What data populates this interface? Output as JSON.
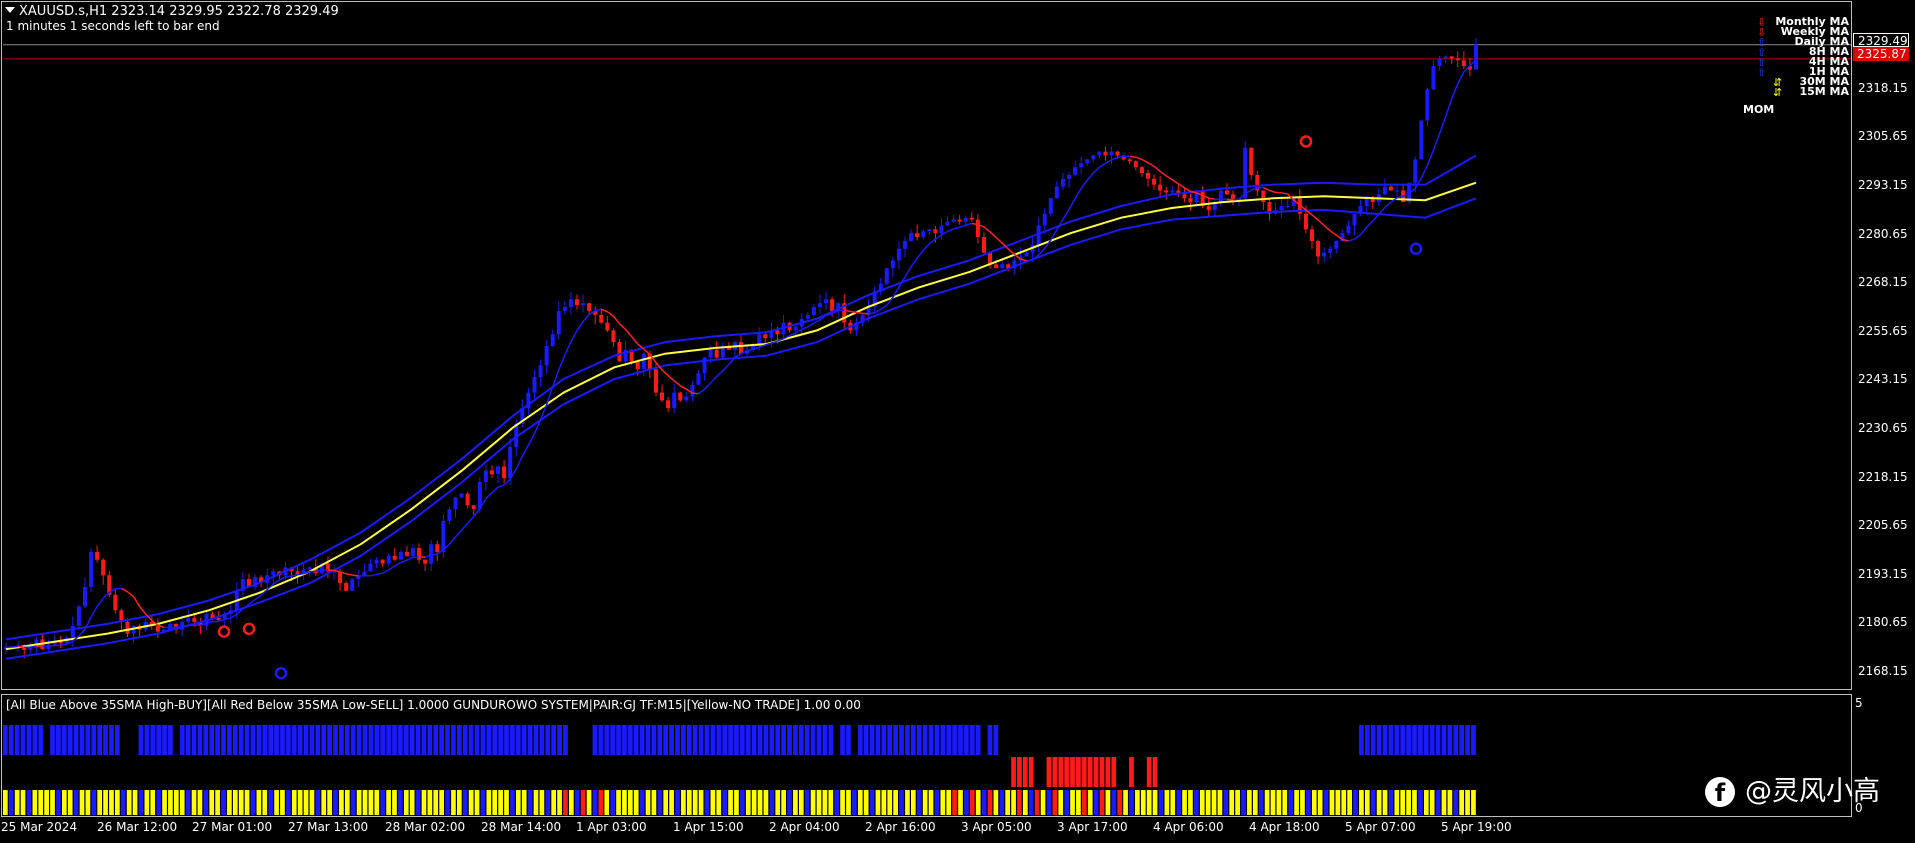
{
  "header": {
    "symbol_ohlc": "XAUUSD.s,H1  2323.14 2329.95 2322.78 2329.49",
    "countdown": "1 minutes 1 seconds left to bar end"
  },
  "price_axis": {
    "labels": [
      "2318.15",
      "2305.65",
      "2293.15",
      "2280.65",
      "2268.15",
      "2255.65",
      "2243.15",
      "2230.65",
      "2218.15",
      "2205.65",
      "2193.15",
      "2180.65",
      "2168.15"
    ],
    "current_price": "2329.49",
    "red_line_price": "2325.87",
    "red_tag_color": "#e00000"
  },
  "time_axis": {
    "labels": [
      "25 Mar 2024",
      "26 Mar 12:00",
      "27 Mar 01:00",
      "27 Mar 13:00",
      "28 Mar 02:00",
      "28 Mar 14:00",
      "1 Apr 03:00",
      "1 Apr 15:00",
      "2 Apr 04:00",
      "2 Apr 16:00",
      "3 Apr 05:00",
      "3 Apr 17:00",
      "4 Apr 06:00",
      "4 Apr 18:00",
      "5 Apr 07:00",
      "5 Apr 19:00"
    ]
  },
  "ma_legend": {
    "items": [
      {
        "label": "Monthly MA",
        "icon": "arrow-down-icon",
        "color": "#ff2020"
      },
      {
        "label": "Weekly MA",
        "icon": "arrow-down-icon",
        "color": "#ff2020"
      },
      {
        "label": "Daily MA",
        "icon": "arrow-up-icon",
        "color": "#2040ff"
      },
      {
        "label": "8H MA",
        "icon": "arrow-up-icon",
        "color": "#2040ff"
      },
      {
        "label": "4H MA",
        "icon": "arrow-up-icon",
        "color": "#2040ff"
      },
      {
        "label": "1H MA",
        "icon": "arrow-up-icon",
        "color": "#2040ff"
      },
      {
        "label": "30M MA",
        "icon": "double-arrow-icon",
        "color": "#ffff00"
      },
      {
        "label": "15M MA",
        "icon": "double-arrow-icon",
        "color": "#ffff00"
      }
    ],
    "mom_label": "MOM"
  },
  "indicator": {
    "text": "[All Blue Above 35SMA High-BUY][All Red Below 35SMA Low-SELL] 1.0000  GUNDUROWO SYSTEM|PAIR:GJ TF:M15|[Yellow-NO TRADE] 1.00 0.00",
    "scale_max": "5",
    "scale_min": "0"
  },
  "watermark": {
    "icon": "facebook-icon",
    "text": "@灵风小高"
  },
  "colors": {
    "bull": "#1a1aff",
    "bear": "#ff1a1a",
    "ma_yellow": "#ffff40",
    "ma_blue": "#1a1aff",
    "ma_red": "#ff2020",
    "no_trade": "#ffff00"
  },
  "chart_data": {
    "type": "candlestick",
    "symbol": "XAUUSD.s",
    "timeframe": "H1",
    "ylim": [
      2164,
      2332
    ],
    "close_path": [
      2174.5,
      2174.6,
      2175.0,
      2173.8,
      2174.3,
      2176.5,
      2174.0,
      2175.2,
      2176.0,
      2175.5,
      2177.0,
      2180.0,
      2185.0,
      2190.0,
      2199.0,
      2197.0,
      2193.0,
      2188.0,
      2184.0,
      2181.0,
      2178.0,
      2180.0,
      2179.0,
      2181.0,
      2180.0,
      2178.5,
      2179.0,
      2180.5,
      2179.0,
      2181.0,
      2182.0,
      2181.0,
      2180.0,
      2183.0,
      2182.0,
      2181.5,
      2183.0,
      2184.0,
      2189.0,
      2192.0,
      2190.0,
      2192.5,
      2191.0,
      2193.0,
      2194.0,
      2193.0,
      2195.0,
      2194.0,
      2193.0,
      2194.5,
      2195.0,
      2193.5,
      2196.0,
      2194.0,
      2194.0,
      2191.0,
      2189.0,
      2192.0,
      2193.0,
      2194.0,
      2196.0,
      2197.0,
      2196.0,
      2198.0,
      2197.0,
      2199.0,
      2198.0,
      2200.0,
      2197.0,
      2196.0,
      2201.0,
      2199.0,
      2207.0,
      2210.0,
      2213.0,
      2214.0,
      2211.0,
      2210.0,
      2217.0,
      2220.0,
      2219.0,
      2221.0,
      2218.0,
      2226.0,
      2232.0,
      2236.0,
      2240.0,
      2244.0,
      2247.0,
      2252.0,
      2255.0,
      2261.0,
      2262.0,
      2264.0,
      2262.5,
      2263.0,
      2261.0,
      2260.0,
      2258.0,
      2256.0,
      2253.0,
      2248.0,
      2251.0,
      2248.0,
      2246.0,
      2250.0,
      2246.0,
      2240.0,
      2238.0,
      2236.0,
      2240.0,
      2238.0,
      2239.0,
      2242.0,
      2245.0,
      2249.0,
      2251.0,
      2249.0,
      2252.0,
      2251.0,
      2253.0,
      2250.0,
      2251.0,
      2252.0,
      2255.0,
      2254.0,
      2256.0,
      2255.0,
      2258.0,
      2256.0,
      2257.0,
      2259.0,
      2260.0,
      2262.0,
      2263.0,
      2264.0,
      2261.0,
      2263.0,
      2258.0,
      2256.0,
      2258.0,
      2260.0,
      2262.0,
      2266.0,
      2268.0,
      2272.0,
      2274.0,
      2277.0,
      2279.0,
      2281.0,
      2280.0,
      2281.5,
      2282.0,
      2281.0,
      2283.0,
      2284.0,
      2284.5,
      2284.0,
      2285.0,
      2284.5,
      2280.0,
      2276.0,
      2273.0,
      2272.0,
      2273.0,
      2272.0,
      2274.0,
      2275.0,
      2276.0,
      2278.0,
      2283.0,
      2286.0,
      2290.0,
      2293.0,
      2295.0,
      2296.0,
      2298.0,
      2299.0,
      2300.0,
      2301.0,
      2302.0,
      2301.0,
      2302.0,
      2301.0,
      2300.0,
      2299.5,
      2298.0,
      2296.5,
      2295.0,
      2293.5,
      2292.0,
      2291.5,
      2292.0,
      2291.0,
      2290.0,
      2289.0,
      2292.0,
      2288.0,
      2287.0,
      2289.0,
      2292.0,
      2291.0,
      2289.0,
      2290.0,
      2303.0,
      2296.0,
      2292.0,
      2289.0,
      2286.0,
      2287.0,
      2288.0,
      2288.0,
      2290.0,
      2286.0,
      2282.0,
      2279.0,
      2275.0,
      2276.0,
      2277.0,
      2279.0,
      2281.0,
      2283.0,
      2286.0,
      2288.0,
      2290.0,
      2289.0,
      2291.0,
      2293.0,
      2292.0,
      2292.0,
      2289.0,
      2294.0,
      2300.0,
      2310.0,
      2318.0,
      2324.0,
      2326.0,
      2326.5,
      2326.0,
      2325.5,
      2324.0,
      2323.1,
      2329.5
    ],
    "moving_averages": [
      {
        "color": "yellow",
        "values": [
          2174.0,
          2176.0,
          2178.0,
          2180.5,
          2184.0,
          2188.5,
          2194.0,
          2201.0,
          2210.0,
          2220.0,
          2231.0,
          2240.0,
          2246.5,
          2250.0,
          2251.5,
          2252.5,
          2256.0,
          2262.0,
          2267.0,
          2271.0,
          2276.0,
          2281.0,
          2285.0,
          2287.5,
          2289.0,
          2290.0,
          2290.5,
          2290.0,
          2289.5,
          2294.0
        ]
      },
      {
        "color": "blue-upper",
        "values": [
          2176.5,
          2178.5,
          2180.5,
          2183.0,
          2186.5,
          2191.0,
          2197.0,
          2204.0,
          2213.0,
          2223.0,
          2234.0,
          2243.5,
          2249.5,
          2253.0,
          2254.5,
          2255.5,
          2259.0,
          2265.0,
          2270.0,
          2274.0,
          2279.0,
          2284.0,
          2288.0,
          2291.0,
          2292.5,
          2293.5,
          2294.0,
          2293.5,
          2293.5,
          2301.0
        ]
      },
      {
        "color": "blue-lower",
        "values": [
          2171.5,
          2173.5,
          2175.5,
          2178.0,
          2181.5,
          2186.0,
          2191.0,
          2198.0,
          2207.0,
          2217.0,
          2228.0,
          2237.0,
          2243.5,
          2247.0,
          2248.5,
          2249.5,
          2253.0,
          2259.0,
          2264.0,
          2268.0,
          2273.0,
          2278.0,
          2282.0,
          2284.5,
          2285.5,
          2286.5,
          2287.0,
          2286.0,
          2285.0,
          2290.0
        ]
      }
    ],
    "indicator_rows": [
      {
        "row": "top",
        "pattern": "blue buy bars with gaps; blue returns at end"
      },
      {
        "row": "middle",
        "pattern": "red sell bars around 4 Apr 18:00 to 5 Apr 07:00"
      },
      {
        "row": "bottom",
        "pattern": "mixed yellow/blue/red no-trade bars"
      }
    ]
  }
}
